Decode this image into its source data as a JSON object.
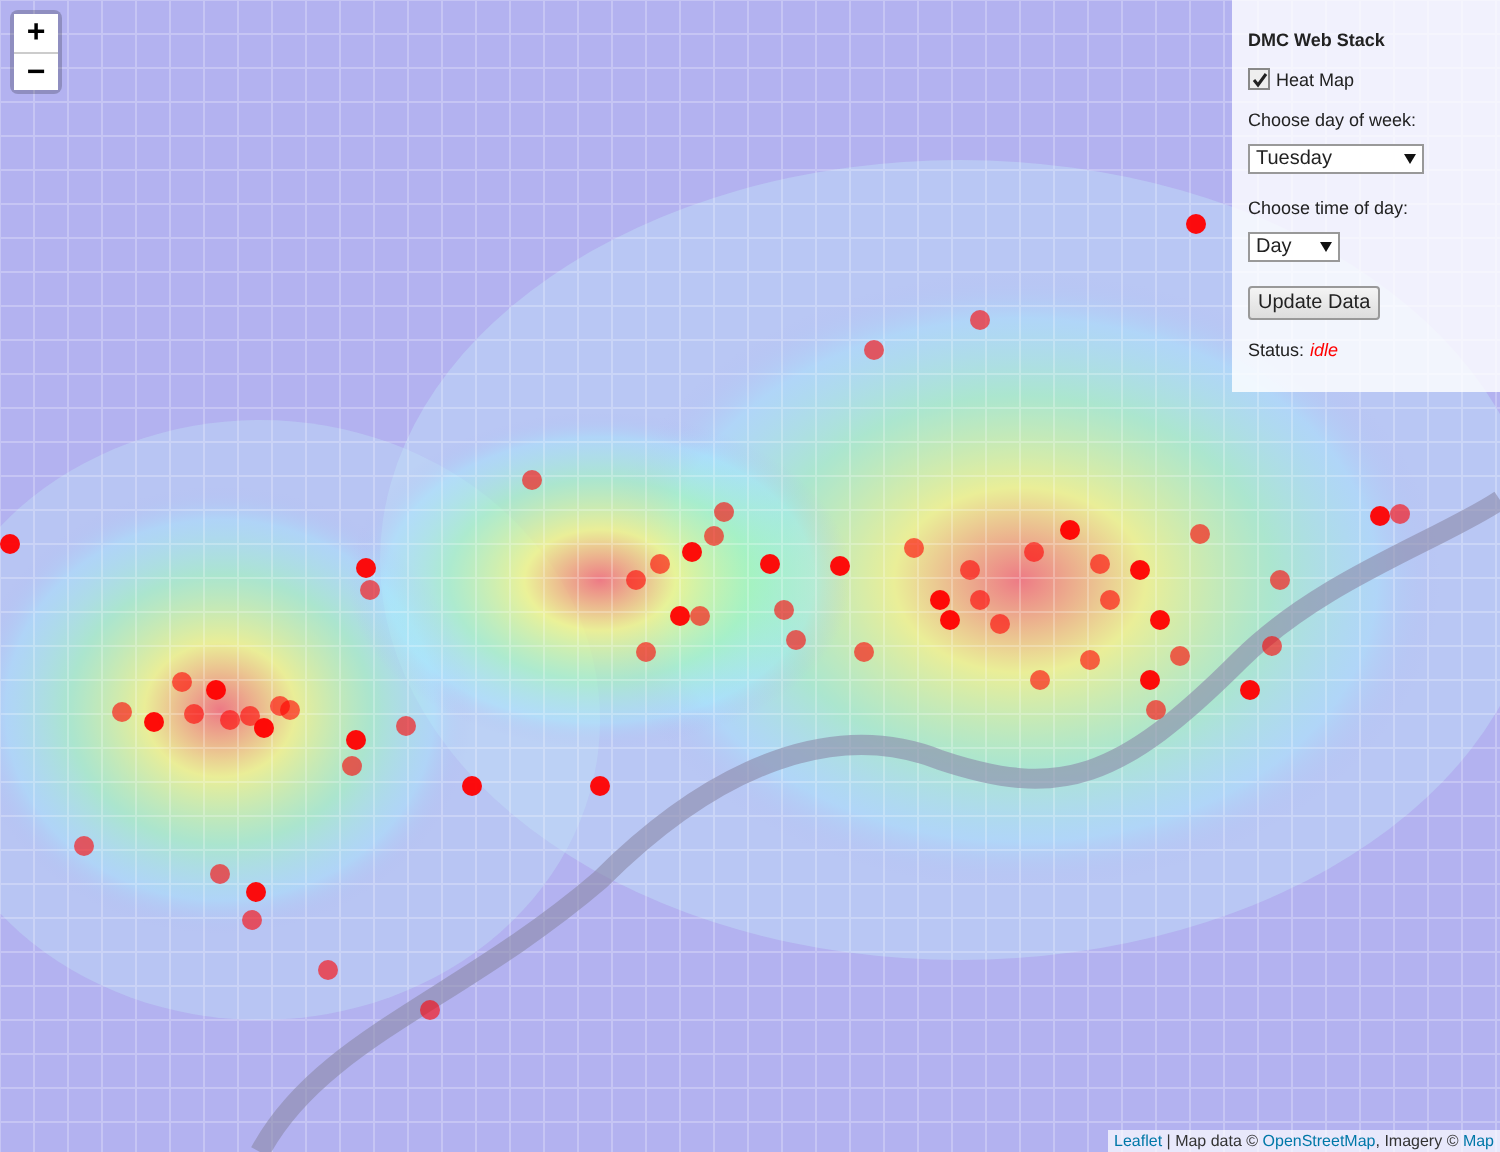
{
  "zoom_controls": [
    {
      "label": "+"
    },
    {
      "label": "−"
    }
  ],
  "panel": {
    "title": "DMC Web Stack",
    "heat_map": {
      "label": "Heat Map",
      "checked": true
    },
    "day": {
      "label": "Choose day of week:",
      "value": "Tuesday"
    },
    "time": {
      "label": "Choose time of day:",
      "value": "Day"
    },
    "button": "Update Data",
    "status": {
      "label": "Status:",
      "value": "idle"
    }
  },
  "attribution": [
    {
      "kind": "link",
      "text": "Leaflet"
    },
    {
      "kind": "text",
      "text": " | Map data © "
    },
    {
      "kind": "link",
      "text": "OpenStreetMap"
    },
    {
      "kind": "text",
      "text": ", Imagery © "
    },
    {
      "kind": "link",
      "text": "Map"
    }
  ]
}
